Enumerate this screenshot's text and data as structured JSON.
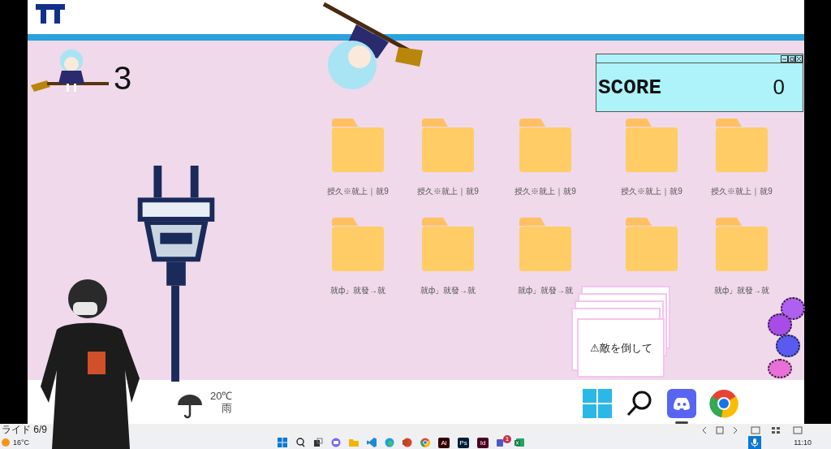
{
  "lives": {
    "count": "3"
  },
  "score_window": {
    "label": "SCORE",
    "value": "0"
  },
  "folders": [
    {
      "label": "授久※就上｜就9"
    },
    {
      "label": "授久※就上｜就9"
    },
    {
      "label": "授久※就上｜就9"
    },
    {
      "label": "授久※就上｜就9"
    },
    {
      "label": "授久※就上｜就9"
    },
    {
      "label": "就ф」就發→就"
    },
    {
      "label": "就ф」就發→就"
    },
    {
      "label": "就ф」就發→就"
    },
    {
      "kind": "folder"
    },
    {
      "label": "就ф」就發→就"
    }
  ],
  "popup": {
    "text": "⚠敵を倒して"
  },
  "orbs": [
    {
      "color": "#b060f0"
    },
    {
      "color": "#a84ce8"
    },
    {
      "color": "#5a5af0"
    },
    {
      "color": "#e870d8"
    }
  ],
  "weather": {
    "temp": "20℃",
    "condition": "雨"
  },
  "dock": [
    {
      "kind": "start",
      "selected": false
    },
    {
      "kind": "search",
      "selected": false
    },
    {
      "kind": "discord",
      "selected": true
    },
    {
      "kind": "chrome",
      "selected": false
    }
  ],
  "slide_status": {
    "slide": "ライド 6/9"
  },
  "taskbar": {
    "temp": "16°C",
    "time": "11:10",
    "apps": [
      {
        "kind": "start"
      },
      {
        "kind": "search"
      },
      {
        "kind": "taskview"
      },
      {
        "kind": "chat"
      },
      {
        "kind": "explorer"
      },
      {
        "kind": "vscode"
      },
      {
        "kind": "edge"
      },
      {
        "kind": "powerpoint"
      },
      {
        "kind": "chrome"
      },
      {
        "kind": "tile",
        "label": "Ai",
        "color": "#330000"
      },
      {
        "kind": "tile",
        "label": "Ps",
        "color": "#001e36"
      },
      {
        "kind": "tile",
        "label": "Id",
        "color": "#49021f"
      },
      {
        "kind": "teams",
        "badge": "1"
      },
      {
        "kind": "excel"
      }
    ]
  }
}
